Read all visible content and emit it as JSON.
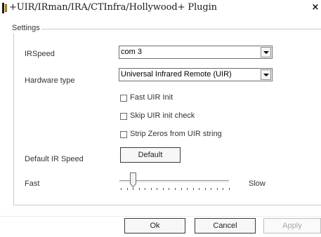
{
  "window": {
    "title": "+UIR/IRman/IRA/CTInfra/Hollywood+ Plugin",
    "close_glyph": "×"
  },
  "settings": {
    "group_label": "Settings",
    "ir_speed": {
      "label": "IRSpeed",
      "value": "com 3"
    },
    "hardware_type": {
      "label": "Hardware type",
      "value": "Universal Infrared Remote (UIR)"
    },
    "checkboxes": [
      {
        "label": "Fast UIR Init",
        "checked": false
      },
      {
        "label": "Skip UIR init check",
        "checked": false
      },
      {
        "label": "Strip Zeros from UIR string",
        "checked": false
      }
    ],
    "default_ir_speed": {
      "label": "Default IR Speed",
      "button_label": "Default"
    },
    "speed_slider": {
      "min_label": "Fast",
      "max_label": "Slow",
      "position": 0.1,
      "tick_count": 19
    }
  },
  "footer": {
    "ok_label": "Ok",
    "cancel_label": "Cancel",
    "apply_label": "Apply"
  }
}
